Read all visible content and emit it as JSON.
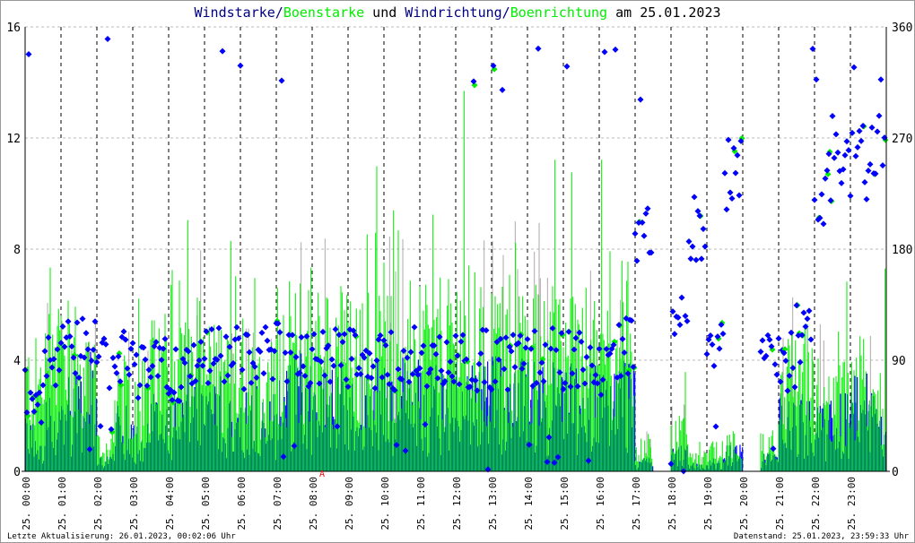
{
  "chart_data": {
    "type": "bar",
    "title_parts": [
      {
        "text": "Windstarke",
        "color": "#000080"
      },
      {
        "text": "/",
        "color": "#000080"
      },
      {
        "text": "Boenstarke",
        "color": "#00ee00"
      },
      {
        "text": " und ",
        "color": "#000000"
      },
      {
        "text": "Windrichtung",
        "color": "#000080"
      },
      {
        "text": "/",
        "color": "#000080"
      },
      {
        "text": "Boenrichtung",
        "color": "#00ee00"
      },
      {
        "text": " am 25.01.2023",
        "color": "#000000"
      }
    ],
    "ylim_left": [
      0,
      16
    ],
    "yticks_left": [
      "0",
      "4",
      "8",
      "12",
      "16"
    ],
    "ylim_right": [
      0,
      360
    ],
    "yticks_right": [
      "0",
      "90",
      "180",
      "270",
      "360"
    ],
    "xticks": [
      "25. 00:00",
      "25. 01:00",
      "25. 02:00",
      "25. 03:00",
      "25. 04:00",
      "25. 05:00",
      "25. 06:00",
      "25. 07:00",
      "25. 08:00",
      "25. 09:00",
      "25. 10:00",
      "25. 11:00",
      "25. 12:00",
      "25. 13:00",
      "25. 14:00",
      "25. 15:00",
      "25. 16:00",
      "25. 17:00",
      "25. 18:00",
      "25. 19:00",
      "25. 20:00",
      "25. 21:00",
      "25. 22:00",
      "25. 23:00"
    ],
    "interval_minutes": 30,
    "series": [
      {
        "name": "Windstarke",
        "color": "#0000ff",
        "values": [
          1.2,
          1.8,
          2.5,
          2.8,
          0.4,
          1.5,
          1.2,
          1.8,
          1.8,
          2.5,
          2.2,
          2.0,
          2.2,
          1.8,
          2.6,
          2.8,
          2.5,
          2.6,
          2.4,
          2.6,
          2.5,
          2.6,
          2.6,
          2.5,
          2.7,
          2.6,
          2.6,
          2.6,
          2.6,
          2.5,
          2.6,
          2.4,
          2.4,
          2.8,
          0.3,
          0.0,
          0.6,
          0.2,
          0.3,
          0.6,
          0.0,
          0.4,
          1.8,
          1.8,
          1.6,
          1.8,
          2.2,
          1.8
        ]
      },
      {
        "name": "Boenstarke",
        "color": "#00ee00",
        "values": [
          3.5,
          4.2,
          4.5,
          3.5,
          1.0,
          3.0,
          3.0,
          4.0,
          4.2,
          4.5,
          4.0,
          3.6,
          3.5,
          3.5,
          5.0,
          5.0,
          4.8,
          5.0,
          4.5,
          4.8,
          5.2,
          5.0,
          4.8,
          5.0,
          5.5,
          5.2,
          5.0,
          5.2,
          5.0,
          5.0,
          5.0,
          4.8,
          4.6,
          5.5,
          1.0,
          0.0,
          1.5,
          0.5,
          0.8,
          1.2,
          0.0,
          1.0,
          3.8,
          4.0,
          3.0,
          3.0,
          3.5,
          3.0
        ]
      },
      {
        "name": "Windrichtung",
        "color": "#0000ff",
        "unit": "deg",
        "values": [
          60,
          90,
          100,
          100,
          90,
          95,
          80,
          85,
          80,
          80,
          95,
          95,
          90,
          95,
          95,
          90,
          90,
          95,
          90,
          90,
          90,
          95,
          90,
          95,
          90,
          90,
          90,
          95,
          90,
          95,
          90,
          90,
          80,
          100,
          200,
          210,
          130,
          200,
          100,
          240,
          150,
          90,
          90,
          110,
          230,
          260,
          250,
          265
        ]
      },
      {
        "name": "Boenrichtung",
        "color": "#00ee00",
        "unit": "deg",
        "values": [
          60,
          90,
          100,
          100,
          90,
          95,
          80,
          85,
          80,
          80,
          95,
          95,
          90,
          95,
          95,
          90,
          90,
          95,
          90,
          90,
          90,
          95,
          90,
          95,
          90,
          90,
          90,
          95,
          90,
          95,
          90,
          90,
          80,
          100,
          200,
          210,
          130,
          200,
          100,
          240,
          150,
          90,
          90,
          110,
          230,
          260,
          250,
          265
        ]
      }
    ],
    "marker_label": "A",
    "grid": true
  },
  "footer": {
    "last_update": "Letzte Aktualisierung: 26.01.2023, 00:02:06 Uhr",
    "data_state": "Datenstand: 25.01.2023, 23:59:33 Uhr"
  }
}
